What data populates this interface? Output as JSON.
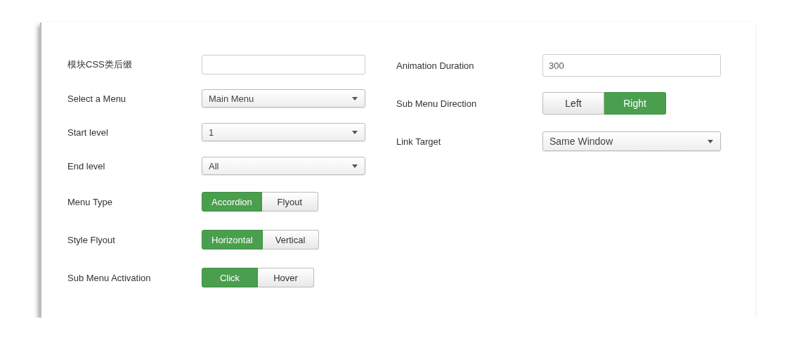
{
  "columns": [
    {
      "fields": [
        {
          "label": "模块CSS类后缀",
          "kind": "text"
        },
        {
          "label": "Select a Menu",
          "kind": "select",
          "value": "Main Menu"
        },
        {
          "label": "Start level",
          "kind": "select",
          "value": "1"
        },
        {
          "label": "End level",
          "kind": "select",
          "value": "All"
        },
        {
          "label": "Menu Type",
          "kind": "toggle",
          "options": [
            {
              "label": "Accordion",
              "selected": true
            },
            {
              "label": "Flyout",
              "selected": false
            }
          ]
        },
        {
          "label": "Style Flyout",
          "kind": "toggle",
          "options": [
            {
              "label": "Horizontal",
              "selected": true
            },
            {
              "label": "Vertical",
              "selected": false
            }
          ]
        },
        {
          "label": "Sub Menu Activation",
          "kind": "toggle",
          "options": [
            {
              "label": "Click",
              "selected": true
            },
            {
              "label": "Hover",
              "selected": false
            }
          ]
        }
      ]
    },
    {
      "fields": [
        {
          "label": "Animation Duration",
          "kind": "text",
          "value": "300"
        },
        {
          "label": "Sub Menu Direction",
          "kind": "toggle",
          "options": [
            {
              "label": "Left",
              "selected": false
            },
            {
              "label": "Right",
              "selected": true
            }
          ]
        },
        {
          "label": "Link Target",
          "kind": "select",
          "value": "Same Window"
        }
      ]
    }
  ]
}
